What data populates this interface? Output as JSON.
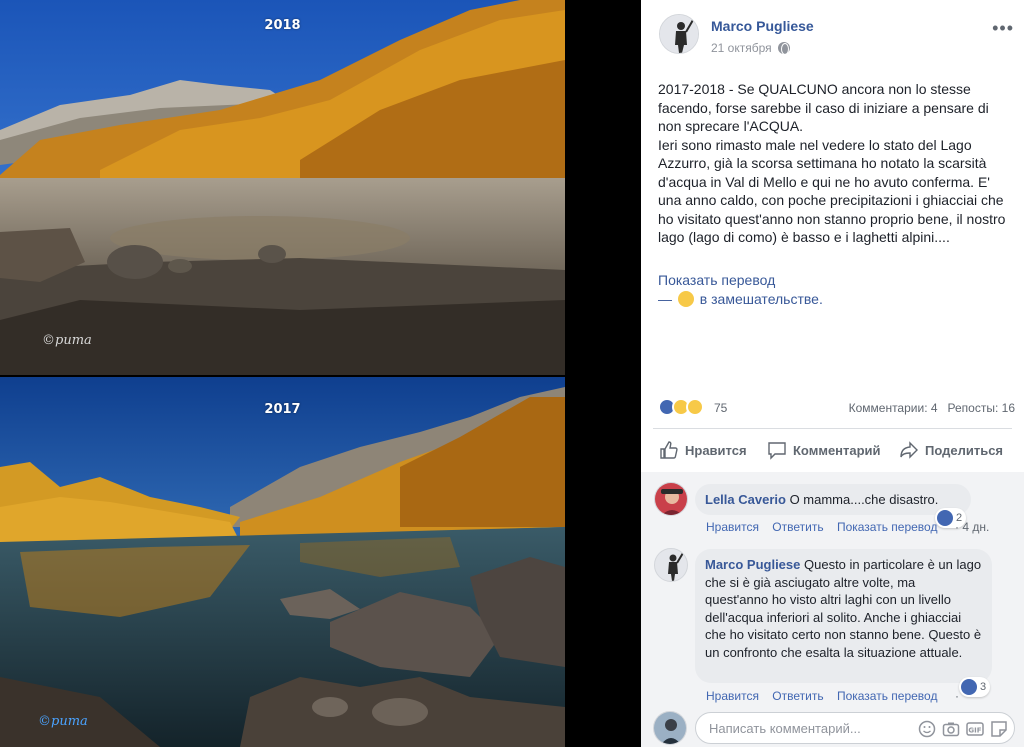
{
  "photos": {
    "top_year": "2018",
    "bottom_year": "2017",
    "top_watermark": "©puma",
    "bottom_watermark": "©puma"
  },
  "post": {
    "author": "Marco Pugliese",
    "date": "21 октября",
    "text": "2017-2018 - Se QUALCUNO ancora non lo stesse facendo, forse sarebbe il caso di iniziare a pensare di non sprecare l'ACQUA.\nIeri sono rimasto male nel vedere lo stato del Lago Azzurro, già la scorsa settimana ho notato la scarsità d'acqua in Val di Mello e qui ne ho avuto conferma. E' una anno caldo, con poche precipitazioni i ghiacciai che ho visitato quest'anno non stanno proprio bene, il nostro lago (lago di como) è basso e i laghetti alpini....",
    "see_translation": "Показать перевод",
    "feeling_prefix": "—",
    "feeling_text": "в замешательстве.",
    "more_icon": "ellipsis-icon"
  },
  "stats": {
    "reaction_count": "75",
    "comments": "Комментарии: 4",
    "shares": "Репосты: 16",
    "reaction_icons": [
      "like-icon",
      "sad-icon",
      "wow-icon"
    ]
  },
  "actions": {
    "like": "Нравится",
    "comment": "Комментарий",
    "share": "Поделиться"
  },
  "comments": [
    {
      "author": "Lella Caverio",
      "text": "O mamma....che disastro.",
      "like": "Нравится",
      "reply": "Ответить",
      "translate": "Показать перевод",
      "time": "· 4 дн.",
      "reactions": "2"
    },
    {
      "author": "Marco Pugliese",
      "text": "Questo in particolare è un lago che si è già asciugato altre volte, ma quest'anno ho visto altri laghi con un livello dell'acqua inferiori al solito. Anche i ghiacciai che ho visitato certo non stanno bene. Questo è un confronto che esalta la situazione attuale.",
      "like": "Нравится",
      "reply": "Ответить",
      "translate": "Показать перевод",
      "time": "·",
      "reactions": "3"
    }
  ],
  "composer": {
    "placeholder": "Написать комментарий...",
    "icons": [
      "emoji-icon",
      "camera-icon",
      "gif-icon",
      "sticker-icon"
    ]
  },
  "colors": {
    "link": "#365899",
    "like_blue": "#4267b2",
    "comment_bg": "#f2f3f5",
    "bubble_bg": "#e9ebee"
  }
}
